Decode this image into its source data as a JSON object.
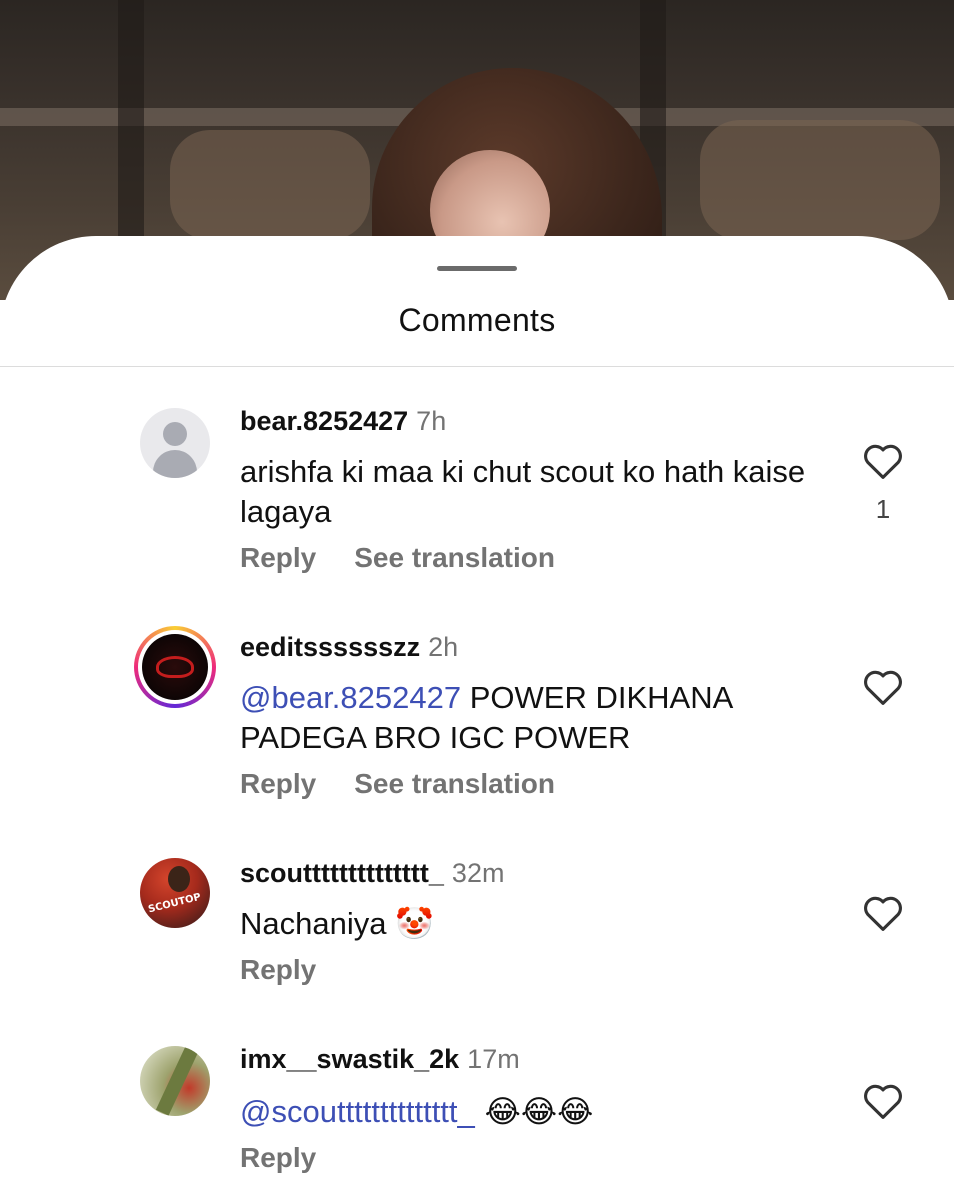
{
  "sheet": {
    "title": "Comments"
  },
  "comments": [
    {
      "username": "bear.8252427",
      "time": "7h",
      "text": "arishfa  ki maa ki chut scout ko hath kaise lagaya",
      "reply_label": "Reply",
      "translate_label": "See translation",
      "likes": "1",
      "avatar": "default-user-icon"
    },
    {
      "username": "eeditsssssszz",
      "time": "2h",
      "mention": "@bear.8252427",
      "text": " POWER DIKHANA PADEGA BRO IGC POWER",
      "reply_label": "Reply",
      "translate_label": "See translation",
      "avatar": "story-ring-avatar"
    },
    {
      "username": "scoutttttttttttttt_",
      "time": "32m",
      "text": "Nachaniya ",
      "emoji": "🤡",
      "reply_label": "Reply",
      "avatar_tag": "SCOUTOP"
    },
    {
      "username": "imx__swastik_2k",
      "time": "17m",
      "mention": "@scoutttttttttttttt_",
      "emoji": " 😂😂😂",
      "reply_label": "Reply"
    }
  ],
  "icons": {
    "like": "heart-outline-icon"
  },
  "colors": {
    "mention": "#3d4fb5",
    "secondary_text": "#737373"
  }
}
